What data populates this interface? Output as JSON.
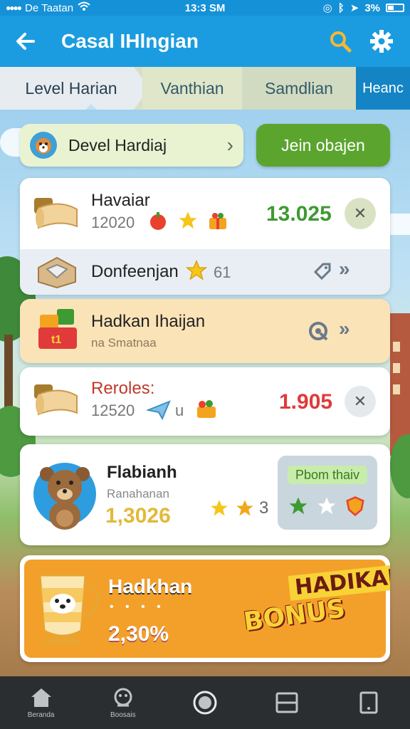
{
  "status_bar": {
    "carrier": "De Taatan",
    "time": "13:3 SM",
    "battery": "3%"
  },
  "app_bar": {
    "title": "Casal IHlngian"
  },
  "tabs": [
    {
      "label": "Level Harian",
      "active": true
    },
    {
      "label": "Vanthian",
      "active": false
    },
    {
      "label": "Samdlian",
      "active": false
    },
    {
      "label": "Heanc",
      "active": false
    }
  ],
  "filter": {
    "dropdown_label": "Devel Hardiaj",
    "join_button": "Jein obajen"
  },
  "cards": {
    "c1": {
      "name": "Havaiar",
      "sub": "12020",
      "score": "13.025",
      "row2_label": "Donfeenjan",
      "row2_count": "61"
    },
    "c2": {
      "name": "Hadkan Ihaijan",
      "sub": "na Smatnaa"
    },
    "c3": {
      "name": "Reroles:",
      "sub": "12520",
      "mid": "u",
      "score": "1.905"
    },
    "c4": {
      "name": "Flabianh",
      "sub": "Ranahanan",
      "value": "1,3026",
      "star_count": "3",
      "promo_tag": "Pbom thaiv"
    },
    "c5": {
      "name": "Hadkhan",
      "value": "2,30%",
      "badge_top": "HADIKAH",
      "badge_bottom": "BONUS"
    }
  },
  "bottom_nav": [
    {
      "label": "Beranda",
      "icon": "home-icon"
    },
    {
      "label": "Boosais",
      "icon": "gift-icon"
    },
    {
      "label": "",
      "icon": "circle-icon"
    },
    {
      "label": "",
      "icon": "list-icon"
    },
    {
      "label": "",
      "icon": "tablet-icon"
    }
  ],
  "colors": {
    "primary": "#1c9ce0",
    "join_green": "#5ba52f",
    "score_green": "#3e9a32",
    "score_red": "#e03a3a",
    "bonus_orange": "#f3a02a"
  }
}
